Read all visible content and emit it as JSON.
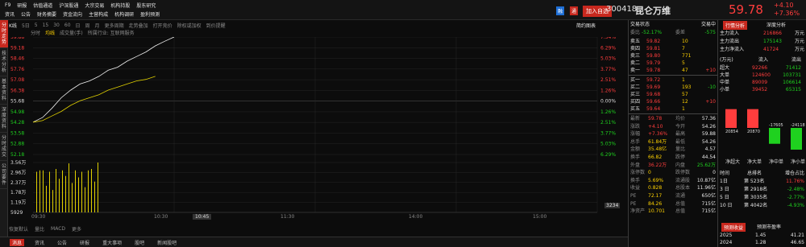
{
  "top": {
    "menu1": [
      "F9",
      "研报",
      "估值通道",
      "沪深股通",
      "大宗交易",
      "机构持股",
      "股东研究"
    ],
    "menu2": [
      "资讯",
      "公告",
      "财务摘要",
      "资金流向",
      "主营构成",
      "机构调研",
      "盈利预测"
    ],
    "badge1": "融",
    "badge2": "通",
    "add_watch": "加入自选",
    "code": "300418",
    "name": "昆仑万维",
    "price": "59.78",
    "chg": "+4.10",
    "pct": "+7.36%"
  },
  "sidebar": [
    "分时走势",
    "技术分析",
    "基本资料",
    "深度资料",
    "分时成交",
    "公司要件"
  ],
  "toolbar": {
    "items": [
      "K线",
      "5日",
      "5",
      "15",
      "30",
      "60",
      "日",
      "周",
      "月",
      "更多周期",
      "走势叠加",
      "打开竞价",
      "除权或加权",
      "到价提醒"
    ],
    "right": "简约图表"
  },
  "toolbar2": {
    "items": [
      "分时",
      "均线",
      "成交量(手)",
      "所属行业: 互联网服务"
    ]
  },
  "price_axis": {
    "left": [
      "59.88",
      "59.18",
      "58.46",
      "57.76",
      "57.08",
      "56.38",
      "55.68",
      "54.98",
      "54.28",
      "53.58",
      "52.88",
      "52.18"
    ],
    "right": [
      "7.54%",
      "6.29%",
      "5.03%",
      "3.77%",
      "2.51%",
      "1.26%",
      "0.00%",
      "1.26%",
      "2.51%",
      "3.77%",
      "5.03%",
      "6.29%"
    ]
  },
  "vol_axis": [
    "3.56万",
    "2.96万",
    "2.37万",
    "1.78万",
    "1.19万",
    "5929"
  ],
  "vol_right": "3234",
  "time_axis": [
    "09:30",
    "10:30",
    "10:45",
    "11:30",
    "14:00",
    "15:00"
  ],
  "indicators": [
    "恢复默认",
    "量比",
    "MACD",
    "更多"
  ],
  "bottom_tabs": [
    "消息",
    "资讯",
    "公告",
    "研报",
    "重大事项",
    "股吧",
    "新闻股吧"
  ],
  "mid": {
    "title": "交易状态",
    "title2": "交易中",
    "webi_label": "委比",
    "webi_val": "-52.17%",
    "wecha_label": "委差",
    "wecha_val": "-575",
    "sells": [
      {
        "l": "卖五",
        "p": "59.82",
        "v": "10"
      },
      {
        "l": "卖四",
        "p": "59.81",
        "v": "7"
      },
      {
        "l": "卖三",
        "p": "59.80",
        "v": "771"
      },
      {
        "l": "卖二",
        "p": "59.79",
        "v": "5"
      },
      {
        "l": "卖一",
        "p": "59.78",
        "v": "47",
        "d": "+10"
      }
    ],
    "buys": [
      {
        "l": "买一",
        "p": "59.72",
        "v": "1",
        "d": ""
      },
      {
        "l": "买二",
        "p": "59.69",
        "v": "193",
        "d": "-10"
      },
      {
        "l": "买三",
        "p": "59.68",
        "v": "57",
        "d": ""
      },
      {
        "l": "买四",
        "p": "59.66",
        "v": "12",
        "d": "+10"
      },
      {
        "l": "买五",
        "p": "59.64",
        "v": "1",
        "d": ""
      }
    ],
    "stats": [
      [
        "最新",
        "59.78",
        "均价",
        "57.36"
      ],
      [
        "涨跌",
        "+4.10",
        "今开",
        "54.26"
      ],
      [
        "涨幅",
        "+7.36%",
        "最高",
        "59.88"
      ],
      [
        "总手",
        "61.84万",
        "最低",
        "54.26"
      ],
      [
        "金额",
        "35.48亿",
        "量比",
        "4.57"
      ],
      [
        "换手",
        "66.82",
        "跌停",
        "44.54"
      ],
      [
        "外盘",
        "36.22万",
        "内盘",
        "25.62万"
      ],
      [
        "涨停数",
        "0",
        "跌停数",
        "0"
      ],
      [
        "换手",
        "5.69%",
        "流通股",
        "10.87亿"
      ],
      [
        "收益",
        "0.828",
        "总股本",
        "11.96亿"
      ],
      [
        "PE",
        "72.17",
        "流通",
        "650亿"
      ],
      [
        "PE",
        "84.26",
        "总值",
        "715亿"
      ],
      [
        "净资产",
        "10.701",
        "总值",
        "715亿"
      ]
    ]
  },
  "right": {
    "tab1": "行情分析",
    "tab2": "深度分析",
    "flow": [
      {
        "l": "主力流入",
        "v": "216866",
        "u": "万元"
      },
      {
        "l": "主力流出",
        "v": "175143",
        "u": "万元"
      },
      {
        "l": "主力净流入",
        "v": "41724",
        "u": "万元"
      }
    ],
    "table_head": [
      "(万元)",
      "流入",
      "流出"
    ],
    "rows": [
      {
        "l": "超大",
        "a": "92266",
        "b": "71412"
      },
      {
        "l": "大单",
        "a": "124600",
        "b": "103731"
      },
      {
        "l": "中单",
        "a": "89009",
        "b": "106614"
      },
      {
        "l": "小单",
        "a": "39452",
        "b": "65315"
      }
    ],
    "bars": [
      {
        "v": "20854",
        "t": "净超大",
        "val": 20854
      },
      {
        "v": "20870",
        "t": "净大单",
        "val": 20870
      },
      {
        "v": "-17605",
        "t": "净中单",
        "val": -17605
      },
      {
        "v": "-24118",
        "t": "净小单",
        "val": -24118
      }
    ],
    "period_head": [
      "时间",
      "总排名",
      "增仓占比"
    ],
    "periods": [
      [
        "1日",
        "第 523名",
        "11.76%"
      ],
      [
        "3 日",
        "第 2918名",
        "-2.48%"
      ],
      [
        "5 日",
        "第 3035名",
        "-2.77%"
      ],
      [
        "10 日",
        "第 4042名",
        "-4.93%"
      ]
    ],
    "fc_tab1": "预测收益",
    "fc_tab2": "预测市盈率",
    "forecast": [
      [
        "2025",
        "1.45",
        "41.21"
      ],
      [
        "2024",
        "1.28",
        "46.65"
      ]
    ]
  },
  "chart_data": {
    "type": "line",
    "series": [
      {
        "name": "price",
        "values": [
          54.3,
          54.6,
          55.2,
          55.9,
          56.4,
          56.8,
          57.0,
          57.3,
          57.7,
          57.9,
          58.3,
          58.6,
          58.9,
          59.3,
          59.6,
          59.88
        ]
      },
      {
        "name": "avg",
        "values": [
          54.3,
          54.4,
          54.7,
          55.0,
          55.4,
          55.7,
          55.9,
          56.1,
          56.4,
          56.6,
          56.8,
          57.0,
          57.1,
          57.3
        ]
      }
    ],
    "volume": [
      2.9,
      3.0,
      3.0,
      1.9,
      2.9,
      1.6,
      3.1,
      2.4,
      3.0,
      2.6,
      3.5,
      2.1,
      3.0,
      2.5,
      2.9,
      1.8,
      3.0,
      3.1,
      2.2,
      3.56
    ],
    "ylim": [
      52.18,
      59.88
    ]
  }
}
